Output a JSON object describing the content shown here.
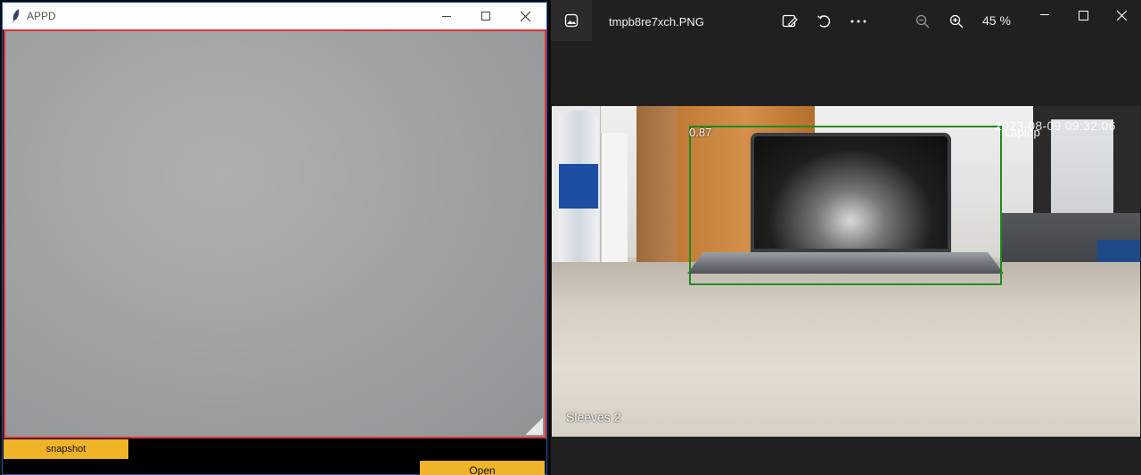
{
  "tk_window": {
    "title": "APPD",
    "snapshot_label": "snapshot",
    "open_label": "Open",
    "colors": {
      "canvas_border": "#d9333a",
      "button_bg": "#f0b429"
    }
  },
  "photos_viewer": {
    "filename": "tmpb8re7xch.PNG",
    "zoom_level": "45 %",
    "toolbar_icons": [
      "edit-image-icon",
      "rotate-icon",
      "more-icon",
      "zoom-out-icon",
      "zoom-in-icon"
    ],
    "image": {
      "score": "0.87",
      "class_label": "Laptop",
      "timestamp": "2023-08-09 09:32:06",
      "caption": "Sleeves 2",
      "colors": {
        "bounding_box": "#1f8a1f"
      }
    }
  }
}
